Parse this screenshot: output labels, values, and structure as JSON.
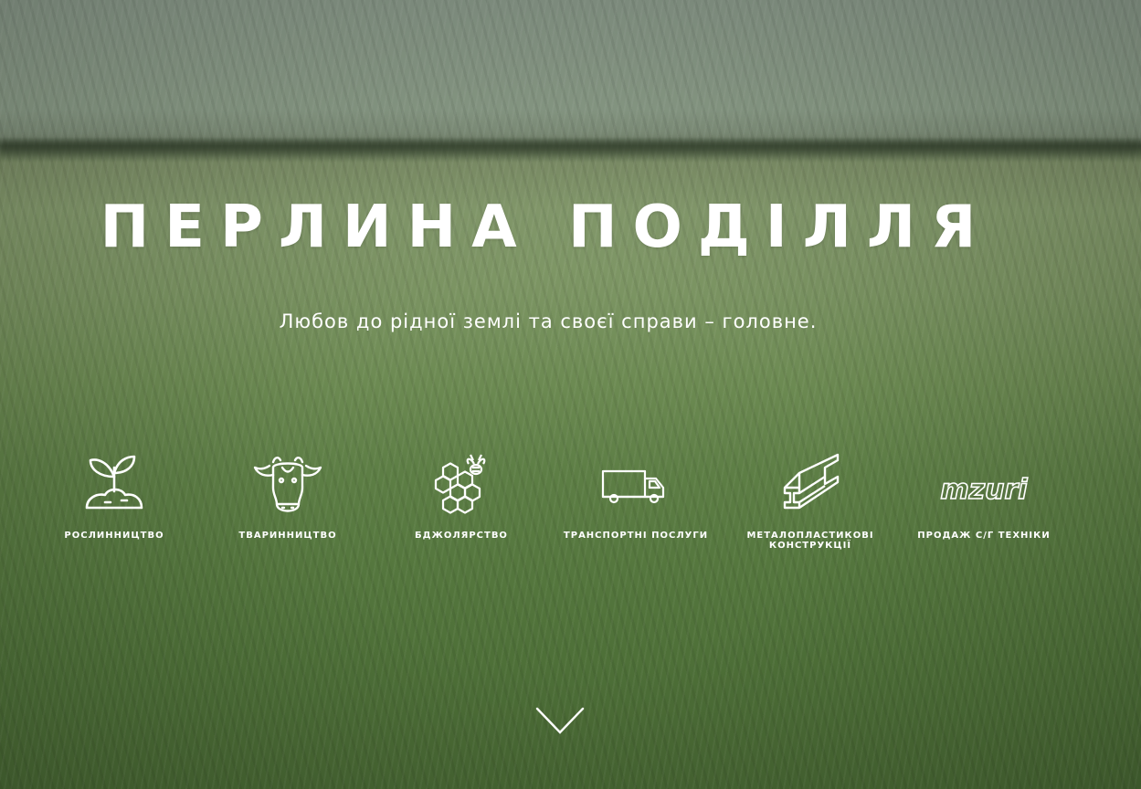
{
  "hero": {
    "title": "ПЕРЛИНА ПОДІЛЛЯ",
    "subtitle": "Любов до рідної землі та своєї справи – головне."
  },
  "services": [
    {
      "icon": "plant-sprout-icon",
      "label": "рослинництво"
    },
    {
      "icon": "cow-head-icon",
      "label": "тваринництво"
    },
    {
      "icon": "honeycomb-bee-icon",
      "label": "бджолярство"
    },
    {
      "icon": "delivery-truck-icon",
      "label": "транспортні послуги"
    },
    {
      "icon": "steel-beam-icon",
      "label": "металопластикові конструкції"
    },
    {
      "icon": "mzuri-logo-icon",
      "label": "продаж с/г техніки",
      "logo_text": "mzuri"
    }
  ],
  "scroll": {
    "icon": "chevron-down-icon"
  },
  "colors": {
    "text": "#ffffff",
    "field_green": "#55773e",
    "sky": "#8a9a8a"
  }
}
